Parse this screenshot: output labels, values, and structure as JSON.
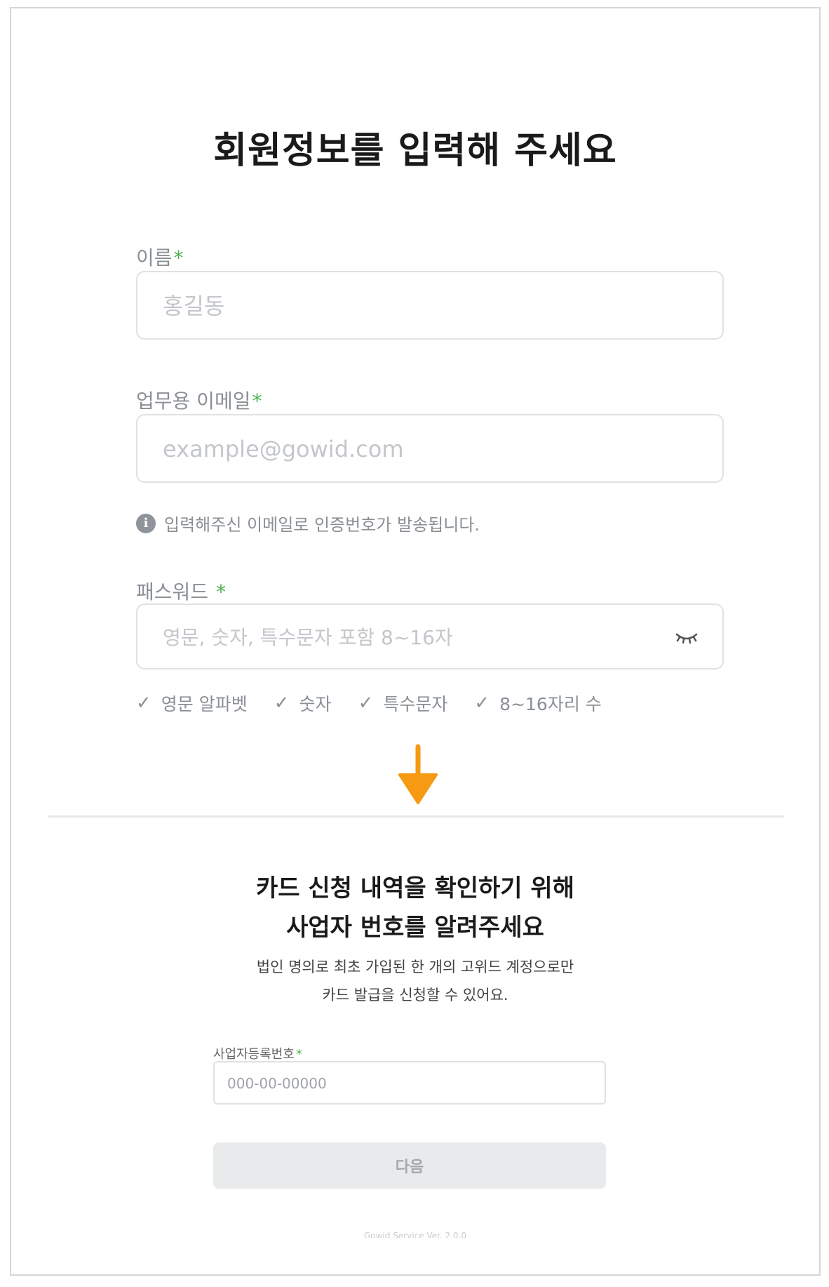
{
  "signup": {
    "title": "회원정보를 입력해 주세요",
    "name": {
      "label": "이름",
      "required_mark": "*",
      "placeholder": "홍길동"
    },
    "email": {
      "label": "업무용 이메일",
      "required_mark": "*",
      "placeholder": "example@gowid.com",
      "hint": "입력해주신 이메일로 인증번호가 발송됩니다.",
      "hint_icon": "info-icon"
    },
    "password": {
      "label": "패스워드",
      "required_mark": "*",
      "placeholder": "영문, 숫자, 특수문자 포함 8~16자",
      "toggle_icon": "eye-closed-icon",
      "checks": [
        {
          "mark": "✓",
          "label": "영문 알파벳"
        },
        {
          "mark": "✓",
          "label": "숫자"
        },
        {
          "mark": "✓",
          "label": "특수문자"
        },
        {
          "mark": "✓",
          "label": "8~16자리 수"
        }
      ]
    }
  },
  "annotation": {
    "arrow_icon": "arrow-down-icon",
    "arrow_color": "#f59a12"
  },
  "business": {
    "title_line1": "카드 신청 내역을 확인하기 위해",
    "title_line2": "사업자 번호를 알려주세요",
    "desc_line1": "법인 명의로 최초 가입된 한 개의 고위드 계정으로만",
    "desc_line2": "카드 발급을 신청할 수 있어요.",
    "reg_label": "사업자등록번호",
    "required_mark": "*",
    "reg_placeholder": "000-00-00000",
    "next_button": "다음",
    "version": "Gowid Service Ver. 2.0.0"
  },
  "colors": {
    "required": "#4caf50",
    "border": "#dfe1e4",
    "disabled_button_bg": "#e8eaec"
  }
}
